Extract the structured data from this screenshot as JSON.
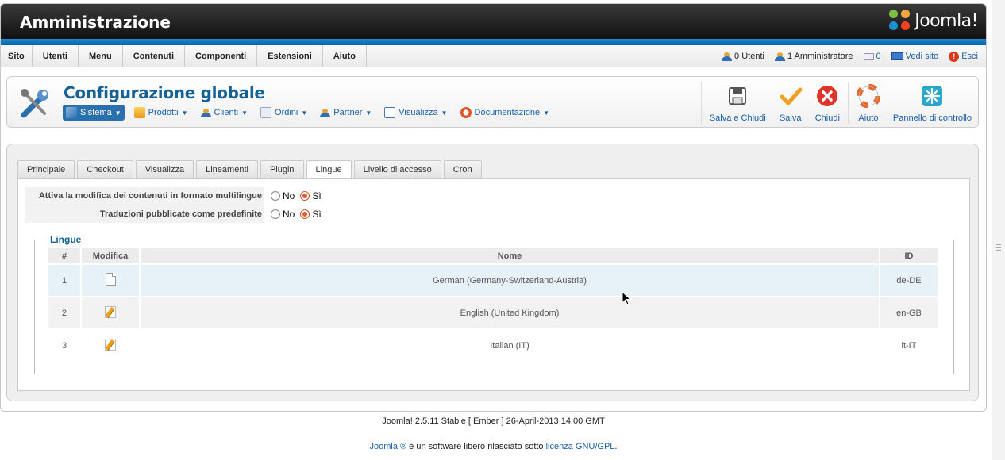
{
  "header": {
    "title": "Amministrazione",
    "brand": "Joomla!"
  },
  "menu": {
    "items": [
      "Sito",
      "Utenti",
      "Menu",
      "Contenuti",
      "Componenti",
      "Estensioni",
      "Aiuto"
    ],
    "status": {
      "users": "0 Utenti",
      "admins": "1 Amministratore",
      "messages": "0",
      "view_site": "Vedi sito",
      "logout": "Esci"
    }
  },
  "toolbar": {
    "title": "Configurazione globale",
    "submenu": [
      {
        "label": "Sistema",
        "icon": "tools-icon",
        "active": true
      },
      {
        "label": "Prodotti",
        "icon": "box-icon"
      },
      {
        "label": "Clienti",
        "icon": "users-icon"
      },
      {
        "label": "Ordini",
        "icon": "orders-icon"
      },
      {
        "label": "Partner",
        "icon": "partner-icon"
      },
      {
        "label": "Visualizza",
        "icon": "view-icon"
      },
      {
        "label": "Documentazione",
        "icon": "lifebuoy-icon"
      }
    ],
    "actions": {
      "save_close": "Salva e Chiudi",
      "save": "Salva",
      "close": "Chiudi",
      "help": "Aiuto",
      "control_panel": "Pannello di controllo"
    }
  },
  "tabs": [
    "Principale",
    "Checkout",
    "Visualizza",
    "Lineamenti",
    "Plugin",
    "Lingue",
    "Livello di accesso",
    "Cron"
  ],
  "active_tab": "Lingue",
  "options": [
    {
      "label": "Attiva la modifica dei contenuti in formato multilingue",
      "no": "No",
      "yes": "Sì",
      "value": "Sì"
    },
    {
      "label": "Traduzioni pubblicate come predefinite",
      "no": "No",
      "yes": "Sì",
      "value": "Sì"
    }
  ],
  "languages": {
    "legend": "Lingue",
    "columns": {
      "num": "#",
      "edit": "Modifica",
      "name": "Nome",
      "id": "ID"
    },
    "rows": [
      {
        "num": "1",
        "name": "German (Germany-Switzerland-Austria)",
        "id": "de-DE",
        "icon": "document-icon"
      },
      {
        "num": "2",
        "name": "English (United Kingdom)",
        "id": "en-GB",
        "icon": "edit-icon"
      },
      {
        "num": "3",
        "name": "Italian (IT)",
        "id": "it-IT",
        "icon": "edit-icon"
      }
    ]
  },
  "footer": {
    "version": "Joomla! 2.5.11 Stable [ Ember ] 26-April-2013 14:00 GMT",
    "brand_link": "Joomla!®",
    "text": " è un software libero rilasciato sotto ",
    "license_link": "licenza GNU/GPL",
    "end": "."
  },
  "colors": {
    "brand_blue": "#146295",
    "link_blue": "#1a5fa6",
    "active_submenu": "#2a6fae"
  }
}
